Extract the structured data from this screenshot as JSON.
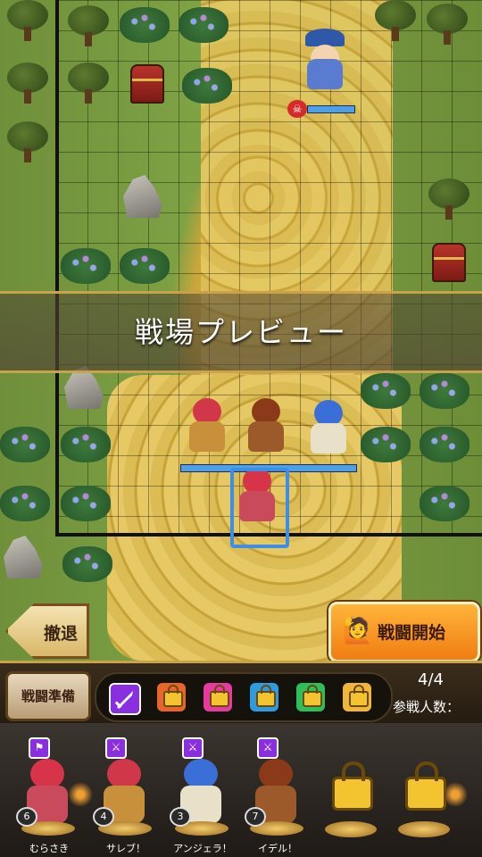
{
  "banner": {
    "title": "戦場プレビュー"
  },
  "actions": {
    "back_label": "撤退",
    "start_label": "戦闘開始"
  },
  "panel": {
    "prep_label": "戦闘準備",
    "participant_count": "4/4",
    "participant_label": "参戦人数："
  },
  "slot_colors": [
    "#8a2fe0",
    "#e9662a",
    "#e63aa0",
    "#2e9be0",
    "#2fbf5a",
    "#f0b63a"
  ],
  "roster": [
    {
      "name": "むらさき",
      "level": "6",
      "hair": "#d7344a",
      "outfit": "#c94a5a"
    },
    {
      "name": "サレブ！",
      "level": "4",
      "hair": "#d0384a",
      "outfit": "#c8903a"
    },
    {
      "name": "アンジェラ！",
      "level": "3",
      "hair": "#3b6fd8",
      "outfit": "#e8e0c8"
    },
    {
      "name": "イデル！",
      "level": "7",
      "hair": "#8a3a18",
      "outfit": "#9c5a2a"
    }
  ],
  "icons": {
    "back": "arrow-left-icon",
    "start": "soldier-raise-icon",
    "weapon": "sword-icon",
    "lock": "lock-icon",
    "enemy_marker": "skull-icon"
  }
}
